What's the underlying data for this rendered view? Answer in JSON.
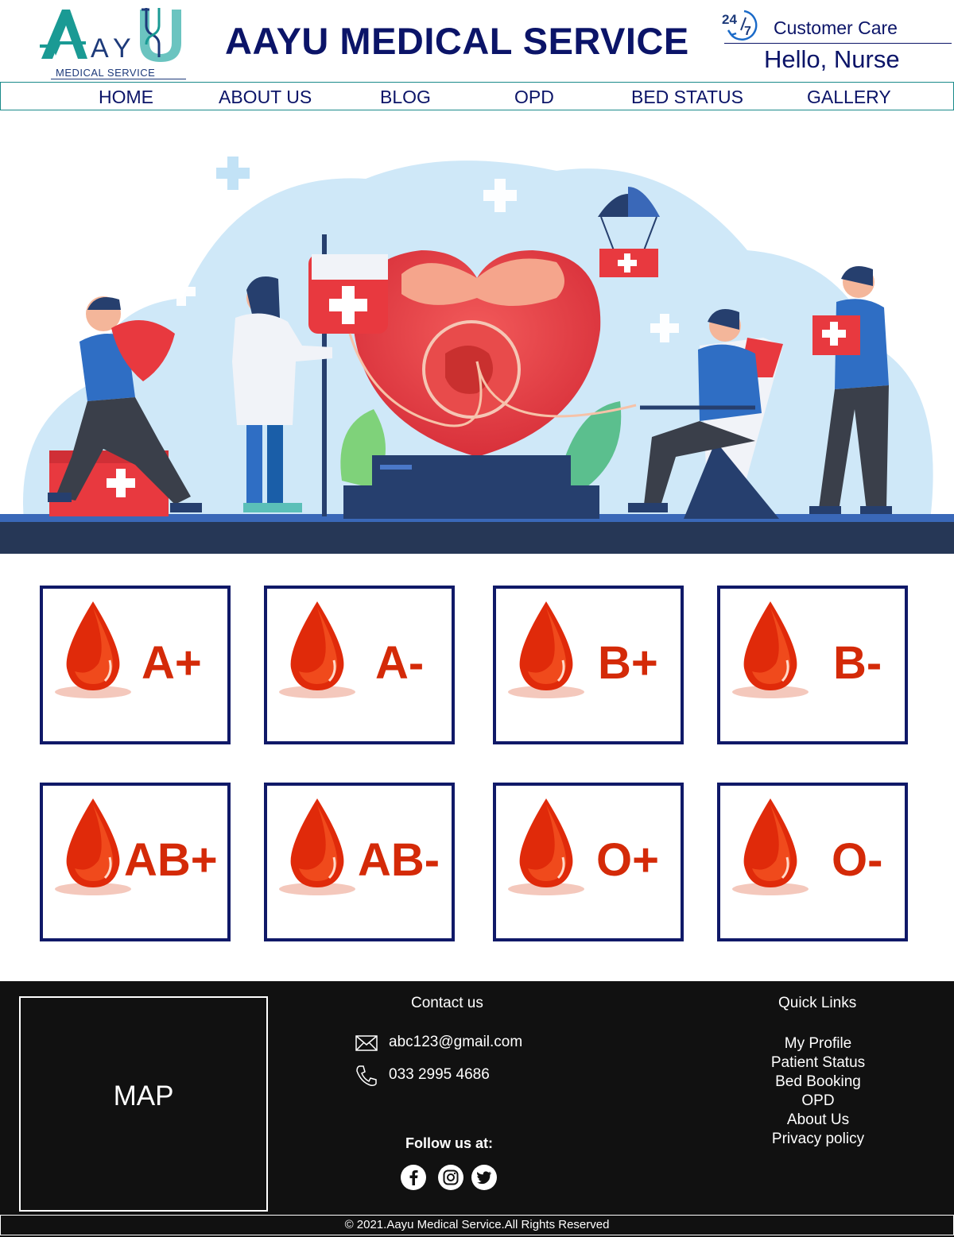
{
  "header": {
    "logo_text": "AAYU",
    "logo_subtitle": "MEDICAL SERVICE",
    "title": "AAYU MEDICAL SERVICE",
    "care_badge": "24/7",
    "care_label": "Customer Care",
    "greeting": "Hello, Nurse"
  },
  "nav": {
    "items": [
      {
        "label": "HOME"
      },
      {
        "label": "ABOUT US"
      },
      {
        "label": "BLOG"
      },
      {
        "label": "OPD"
      },
      {
        "label": "BED STATUS"
      },
      {
        "label": "GALLERY"
      }
    ]
  },
  "hero": {
    "illustration": "blood-donation-illustration"
  },
  "blood_groups": [
    {
      "label": "A+"
    },
    {
      "label": "A-"
    },
    {
      "label": "B+"
    },
    {
      "label": "B-"
    },
    {
      "label": "AB+"
    },
    {
      "label": "AB-"
    },
    {
      "label": "O+"
    },
    {
      "label": "O-"
    }
  ],
  "colors": {
    "primary_navy": "#0b1468",
    "teal": "#1a8a8a",
    "blood_red": "#d42a08",
    "footer_bg": "#111111"
  },
  "footer": {
    "map_label": "MAP",
    "contact_heading": "Contact us",
    "email": "abc123@gmail.com",
    "phone": "033 2995 4686",
    "follow_label": "Follow us at:",
    "social": [
      "facebook-icon",
      "instagram-icon",
      "twitter-icon"
    ],
    "quick_links_heading": "Quick Links",
    "quick_links": [
      {
        "label": "My Profile"
      },
      {
        "label": "Patient Status"
      },
      {
        "label": "Bed Booking"
      },
      {
        "label": "OPD"
      },
      {
        "label": "About Us"
      },
      {
        "label": "Privacy policy"
      }
    ],
    "copyright": "© 2021.Aayu Medical Service.All Rights Reserved"
  }
}
